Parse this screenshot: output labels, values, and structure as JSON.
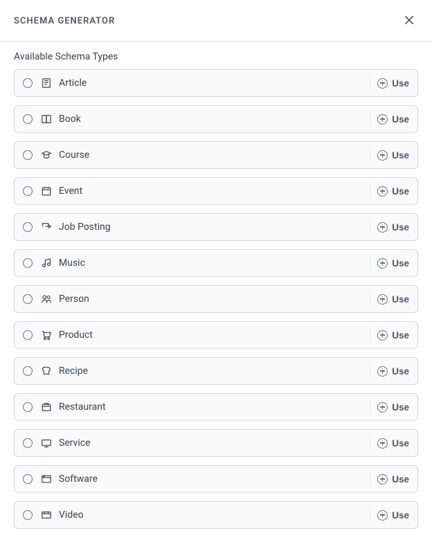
{
  "header": {
    "title": "SCHEMA GENERATOR"
  },
  "subtitle": "Available Schema Types",
  "use_label": "Use",
  "items": [
    {
      "icon": "article",
      "label": "Article"
    },
    {
      "icon": "book",
      "label": "Book"
    },
    {
      "icon": "course",
      "label": "Course"
    },
    {
      "icon": "event",
      "label": "Event"
    },
    {
      "icon": "jobposting",
      "label": "Job Posting"
    },
    {
      "icon": "music",
      "label": "Music"
    },
    {
      "icon": "person",
      "label": "Person"
    },
    {
      "icon": "product",
      "label": "Product"
    },
    {
      "icon": "recipe",
      "label": "Recipe"
    },
    {
      "icon": "restaurant",
      "label": "Restaurant"
    },
    {
      "icon": "service",
      "label": "Service"
    },
    {
      "icon": "software",
      "label": "Software"
    },
    {
      "icon": "video",
      "label": "Video"
    }
  ]
}
